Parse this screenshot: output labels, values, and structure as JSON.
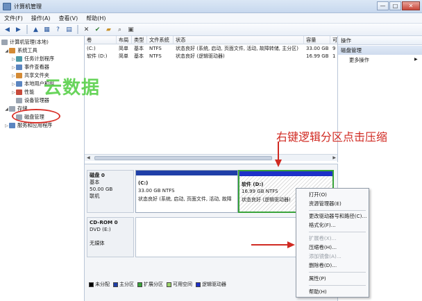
{
  "window": {
    "title": "计算机管理",
    "controls": {
      "minimize": "—",
      "maximize": "□",
      "close": "✕"
    }
  },
  "menu": [
    "文件(F)",
    "操作(A)",
    "查看(V)",
    "帮助(H)"
  ],
  "tree": {
    "root": "计算机管理(本地)",
    "system_tools": "系统工具",
    "task_scheduler": "任务计划程序",
    "event_viewer": "事件查看器",
    "shared_folders": "共享文件夹",
    "local_users": "本地用户和组",
    "performance": "性能",
    "device_manager": "设备管理器",
    "storage": "存储",
    "disk_management": "磁盘管理",
    "services": "服务和应用程序"
  },
  "volumes": {
    "headers": [
      "卷",
      "布局",
      "类型",
      "文件系统",
      "状态",
      "容量",
      "可"
    ],
    "rows": [
      [
        "(C:)",
        "简单",
        "基本",
        "NTFS",
        "状态良好 (系统, 启动, 页面文件, 活动, 故障转储, 主分区)",
        "33.00 GB",
        "9"
      ],
      [
        "软件 (D:)",
        "简单",
        "基本",
        "NTFS",
        "状态良好 (逻辑驱动器)",
        "16.99 GB",
        "1"
      ]
    ]
  },
  "disk0": {
    "name": "磁盘 0",
    "type": "基本",
    "size": "50.00 GB",
    "status": "联机",
    "partitions": [
      {
        "label": "(C:)",
        "size": "33.00 GB NTFS",
        "status": "状态良好 (系统, 启动, 页面文件, 活动, 故障"
      },
      {
        "label": "软件 (D:)",
        "size": "16.99 GB NTFS",
        "status": "状态良好 (逻辑驱动器)"
      }
    ]
  },
  "cdrom": {
    "name": "CD-ROM 0",
    "device": "DVD (E:)",
    "status": "无媒体"
  },
  "legend": [
    "未分配",
    "主分区",
    "扩展分区",
    "可用空间",
    "逻辑驱动器"
  ],
  "legend_colors": [
    "#000000",
    "#1f3fa8",
    "#39a33a",
    "#9bd36a",
    "#1d30c8"
  ],
  "actions": {
    "header": "操作",
    "section": "磁盘管理",
    "more": "更多操作"
  },
  "context_menu": {
    "open": "打开(O)",
    "explore": "资源管理器(E)",
    "change_letter": "更改驱动器号和路径(C)...",
    "format": "格式化(F)...",
    "extend": "扩展卷(X)...",
    "shrink": "压缩卷(H)...",
    "add_mirror": "添加镜像(A)...",
    "delete": "删除卷(D)...",
    "properties": "属性(P)",
    "help": "帮助(H)"
  },
  "annotation": "右键逻辑分区点击压缩",
  "watermark": "云数据",
  "accent": "#d02a22"
}
